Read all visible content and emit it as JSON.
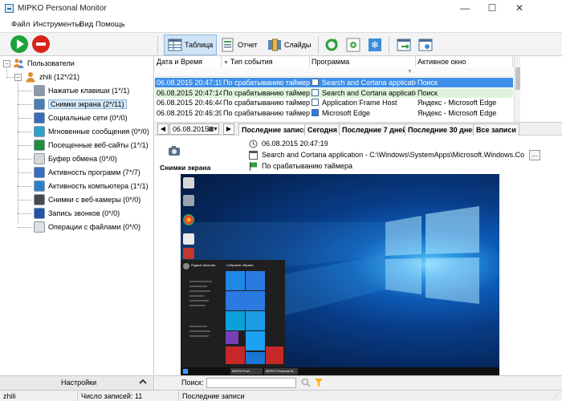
{
  "window": {
    "title": "MIPKO Personal Monitor",
    "minimize_glyph": "—",
    "maximize_glyph": "☐",
    "close_glyph": "✕"
  },
  "menu": [
    "Файл",
    "Инструменты",
    "Вид",
    "Помощь"
  ],
  "toolbar": {
    "views": [
      {
        "label": "Таблица",
        "icon": "table-icon",
        "active": true
      },
      {
        "label": "Отчет",
        "icon": "report-icon",
        "active": false
      },
      {
        "label": "Слайды",
        "icon": "slides-icon",
        "active": false
      }
    ],
    "colors": {
      "start": "#1aa33a",
      "stop": "#d9241c",
      "active_tab_bg": "#cfe3f6"
    }
  },
  "tree": {
    "root": "Пользователи",
    "user": "zhili (12*/21)",
    "items": [
      {
        "label": "Нажатые клавиши (1*/1)",
        "icon": "keyboard-icon",
        "color": "#8c9aa8",
        "selected": false
      },
      {
        "label": "Снимки экрана (2*/11)",
        "icon": "screenshot-icon",
        "color": "#4a7fb5",
        "selected": true
      },
      {
        "label": "Социальные сети (0*/0)",
        "icon": "social-icon",
        "color": "#3b6bb4",
        "selected": false
      },
      {
        "label": "Мгновенные сообщения (0*/0)",
        "icon": "chat-icon",
        "color": "#2aa3c9",
        "selected": false
      },
      {
        "label": "Посещенные веб-сайты (1*/1)",
        "icon": "globe-icon",
        "color": "#1f8f3a",
        "selected": false
      },
      {
        "label": "Буфер обмена (0*/0)",
        "icon": "clipboard-icon",
        "color": "#d8d8d8",
        "selected": false
      },
      {
        "label": "Активность программ (7*/7)",
        "icon": "programs-icon",
        "color": "#3a6cc0",
        "selected": false
      },
      {
        "label": "Активность компьютера (1*/1)",
        "icon": "computer-icon",
        "color": "#2c80c8",
        "selected": false
      },
      {
        "label": "Снимки с веб-камеры (0*/0)",
        "icon": "webcam-icon",
        "color": "#4a4a4a",
        "selected": false
      },
      {
        "label": "Запись звонков (0*/0)",
        "icon": "phone-icon",
        "color": "#2255a8",
        "selected": false
      },
      {
        "label": "Операции с файлами (0*/0)",
        "icon": "file-icon",
        "color": "#e0e0e0",
        "selected": false
      }
    ]
  },
  "settings_label": "Настройки",
  "grid": {
    "columns": [
      "Дата и Время",
      "Тип события",
      "Программа",
      "Активное окно"
    ],
    "rows": [
      {
        "datetime": "06.08.2015 20:47:19",
        "event": "По срабатыванию таймера",
        "program": "Search and Cortana application",
        "window": "Поиск",
        "icon": "cortana-icon",
        "state": "selected"
      },
      {
        "datetime": "06.08.2015 20:47:14",
        "event": "По срабатыванию таймера",
        "program": "Search and Cortana application",
        "window": "Поиск",
        "icon": "cortana-icon",
        "state": "highlight"
      },
      {
        "datetime": "06.08.2015 20:46:44",
        "event": "По срабатыванию таймера",
        "program": "Application Frame Host",
        "window": "Яндекс - Microsoft Edge",
        "icon": "app-icon",
        "state": "normal"
      },
      {
        "datetime": "06.08.2015 20:46:39",
        "event": "По срабатыванию таймера",
        "program": "Microsoft Edge",
        "window": "Яндекс - Microsoft Edge",
        "icon": "edge-icon",
        "state": "normal"
      }
    ],
    "colors": {
      "selected": "#3e8ee8",
      "highlight": "#dff3dc"
    }
  },
  "period": {
    "date": "06.08.2015",
    "prev_glyph": "◀",
    "next_glyph": "▶",
    "tabs": [
      "Последние записи",
      "Сегодня",
      "Последние 7 дней",
      "Последние 30 дней",
      "Все записи"
    ]
  },
  "detail": {
    "caption": "Снимки экрана",
    "datetime": "06.08.2015 20:47:19",
    "program_path": "Search and Cortana application - C:\\Windows\\SystemApps\\Microsoft.Windows.Co",
    "trigger": "По срабатыванию таймера",
    "more_glyph": "..."
  },
  "screenshot": {
    "startmenu_user": "Родион Киселев",
    "startmenu_header": "Собрание обрамо",
    "start_tiles": [
      "#1e88e5",
      "#2a7ae2",
      "#2a7ae2",
      "#0aa1d8",
      "#1e9be6",
      "#7a3fb5",
      "#1da1f2",
      "#c62828",
      "#1976d2",
      "#c62828"
    ],
    "taskbar_items": [
      "MIPKO Prof...",
      "MIPKO Personal M..."
    ]
  },
  "search": {
    "label": "Поиск:",
    "value": ""
  },
  "status": {
    "user": "zhili",
    "count": "Число записей: 11",
    "filter": "Последние записи"
  }
}
